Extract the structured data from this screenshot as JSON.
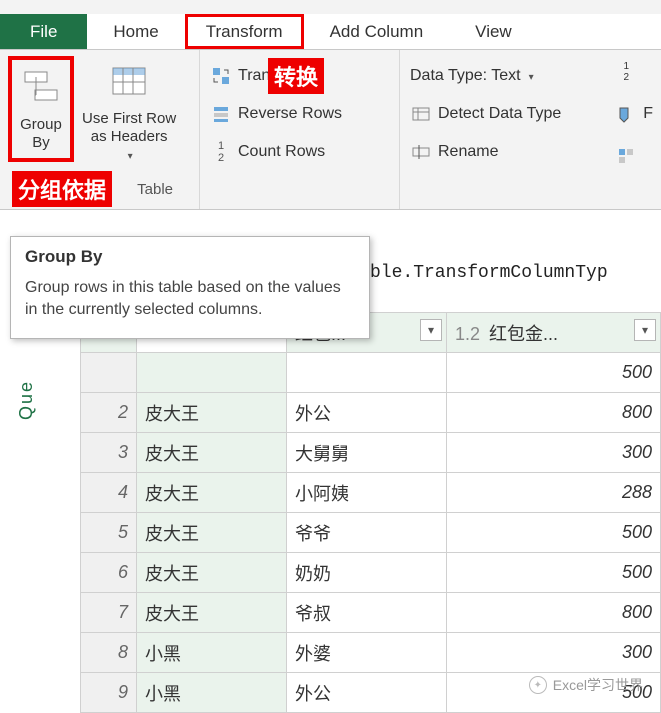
{
  "tabs": {
    "file": "File",
    "home": "Home",
    "transform": "Transform",
    "addcolumn": "Add Column",
    "view": "View"
  },
  "ribbon": {
    "group_by": "Group\nBy",
    "use_first_row": "Use First Row\nas Headers",
    "transpose": "Transpose",
    "reverse_rows": "Reverse Rows",
    "count_rows": "Count Rows",
    "table_label": "Table",
    "data_type": "Data Type: Text",
    "detect": "Detect Data Type",
    "rename": "Rename"
  },
  "annotations": {
    "zhuanhuan": "转换",
    "fenzu": "分组依据"
  },
  "tooltip": {
    "title": "Group By",
    "body": "Group rows in this table based on the values in the currently selected columns."
  },
  "formula": "ble.TransformColumnTyp",
  "side_label": "Que",
  "columns": {
    "c2_prefix": "",
    "c2_label": "红包...",
    "c3_prefix": "1.2",
    "c3_label": "红包金..."
  },
  "rows": [
    {
      "n": "2",
      "name": "皮大王",
      "rel": "外公",
      "amt": "800"
    },
    {
      "n": "3",
      "name": "皮大王",
      "rel": "大舅舅",
      "amt": "300"
    },
    {
      "n": "4",
      "name": "皮大王",
      "rel": "小阿姨",
      "amt": "288"
    },
    {
      "n": "5",
      "name": "皮大王",
      "rel": "爷爷",
      "amt": "500"
    },
    {
      "n": "6",
      "name": "皮大王",
      "rel": "奶奶",
      "amt": "500"
    },
    {
      "n": "7",
      "name": "皮大王",
      "rel": "爷叔",
      "amt": "800"
    },
    {
      "n": "8",
      "name": "小黑",
      "rel": "外婆",
      "amt": "300"
    },
    {
      "n": "9",
      "name": "小黑",
      "rel": "外公",
      "amt": "500"
    }
  ],
  "hidden_row": {
    "amt": "500"
  },
  "wechat": "Excel学习世界"
}
